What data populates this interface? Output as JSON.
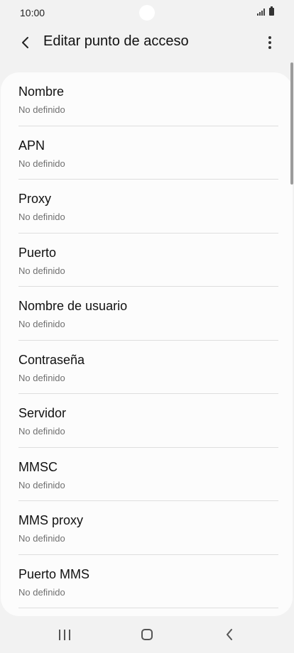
{
  "status_bar": {
    "time": "10:00",
    "icons": [
      "signal-icon",
      "battery-icon"
    ]
  },
  "app_bar": {
    "title": "Editar punto de acceso",
    "back_icon": "chevron-left-icon",
    "more_icon": "more-vertical-icon"
  },
  "settings": [
    {
      "label": "Nombre",
      "value": "No definido"
    },
    {
      "label": "APN",
      "value": "No definido"
    },
    {
      "label": "Proxy",
      "value": "No definido"
    },
    {
      "label": "Puerto",
      "value": "No definido"
    },
    {
      "label": "Nombre de usuario",
      "value": "No definido"
    },
    {
      "label": "Contraseña",
      "value": "No definido"
    },
    {
      "label": "Servidor",
      "value": "No definido"
    },
    {
      "label": "MMSC",
      "value": "No definido"
    },
    {
      "label": "MMS proxy",
      "value": "No definido"
    },
    {
      "label": "Puerto MMS",
      "value": "No definido"
    }
  ],
  "nav_bar": {
    "icons": [
      "recent-apps-icon",
      "home-icon",
      "back-icon"
    ]
  },
  "colors": {
    "background": "#f2f2f2",
    "card": "#fcfcfc",
    "secondary_text": "#707070",
    "divider": "#dedede"
  }
}
